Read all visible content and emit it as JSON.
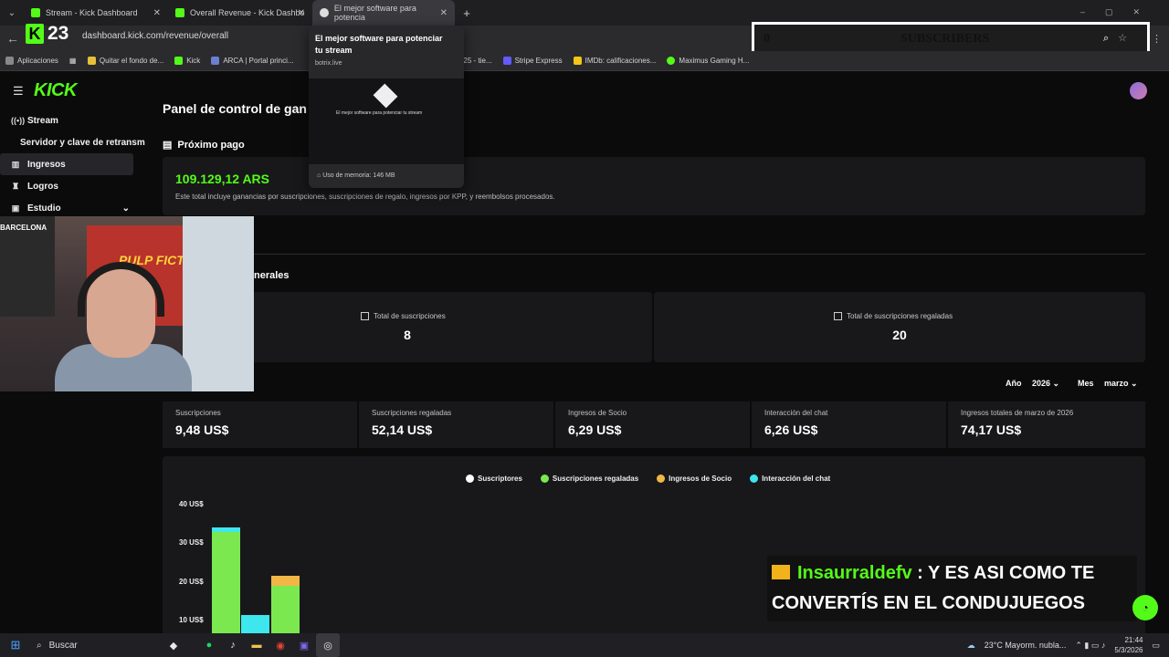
{
  "browser": {
    "tabs": [
      {
        "title": "Stream - Kick Dashboard",
        "active": false
      },
      {
        "title": "Overall Revenue - Kick Dashbo",
        "active": false
      },
      {
        "title": "El mejor software para potencia",
        "active": true
      }
    ],
    "new_tab": "+",
    "url": "dashboard.kick.com/revenue/overall",
    "bookmarks": [
      "Aplicaciones",
      "Quitar el fondo de...",
      "Kick",
      "ARCA | Portal princi...",
      "2025 - tie...",
      "Stripe Express",
      "IMDb: calificaciones...",
      "Maximus Gaming H..."
    ]
  },
  "overlay": {
    "kick_letter": "K",
    "follower_count": "23",
    "subscribers_number": "0",
    "subscribers_label": "SUBSCRIBERS"
  },
  "tab_preview": {
    "title": "El mejor software para potenciar tu stream",
    "domain": "botrix.live",
    "preview_text": "El mejor software para potenciar tu stream",
    "memory": "Uso de memoria: 146 MB"
  },
  "app": {
    "logo": "KICK",
    "sidebar": [
      {
        "label": "Stream",
        "icon": "stream-icon"
      },
      {
        "label": "Servidor y clave de retransm",
        "icon": ""
      },
      {
        "label": "Ingresos",
        "icon": "chart-icon"
      },
      {
        "label": "Logros",
        "icon": "trophy-icon"
      },
      {
        "label": "Estudio",
        "icon": "studio-icon"
      }
    ],
    "page_title": "Panel de control de gan",
    "next_payment": {
      "heading": "Próximo pago",
      "amount": "109.129,12 ARS",
      "currency": "ARS",
      "note": "Este total incluye ganancias por suscripciones, suscripciones de regalo, ingresos por KPP, y reembolsos procesados."
    },
    "general_heading": "nerales",
    "totals": [
      {
        "label": "Total de suscripciones",
        "value": "8"
      },
      {
        "label": "Total de suscripciones regaladas",
        "value": "20"
      }
    ],
    "filters": {
      "year_label": "Año",
      "year_value": "2026",
      "month_label": "Mes",
      "month_value": "marzo"
    },
    "metrics": [
      {
        "label": "Suscripciones",
        "value": "9,48 US$"
      },
      {
        "label": "Suscripciones regaladas",
        "value": "52,14 US$"
      },
      {
        "label": "Ingresos de Socio",
        "value": "6,29 US$"
      },
      {
        "label": "Interacción del chat",
        "value": "6,26 US$"
      },
      {
        "label": "Ingresos totales de marzo de 2026",
        "value": "74,17 US$"
      }
    ]
  },
  "chart_data": {
    "type": "bar",
    "title": "",
    "legend": [
      "Suscriptores",
      "Suscripciones regaladas",
      "Ingresos de Socio",
      "Interacción del chat"
    ],
    "legend_colors": [
      "#ffffff",
      "#7be84f",
      "#f1b645",
      "#3ee6ee"
    ],
    "y_ticks": [
      "40 US$",
      "30 US$",
      "20 US$",
      "10 US$"
    ],
    "ylim": [
      0,
      40
    ],
    "bars": [
      {
        "series": {
          "Suscripciones regaladas": 33,
          "Interacción del chat": 1
        }
      },
      {
        "series": {
          "Suscripciones regaladas": 3,
          "Ingresos de Socio": 3.5,
          "Interacción del chat": 5
        }
      },
      {
        "series": {
          "Suscripciones regaladas": 19,
          "Ingresos de Socio": 2.5
        }
      }
    ]
  },
  "chat_overlay": {
    "username": "Insaurraldefv",
    "message_line1": " : Y ES ASI COMO TE",
    "message_line2": "CONVERTÍS EN EL CONDUJUEGOS"
  },
  "webcam": {
    "flag_text": "BARCELONA",
    "poster_text": "PULP FICTION"
  },
  "taskbar": {
    "search": "Buscar",
    "weather": "23°C  Mayorm. nubla...",
    "time": "21:44",
    "date": "5/3/2026"
  }
}
